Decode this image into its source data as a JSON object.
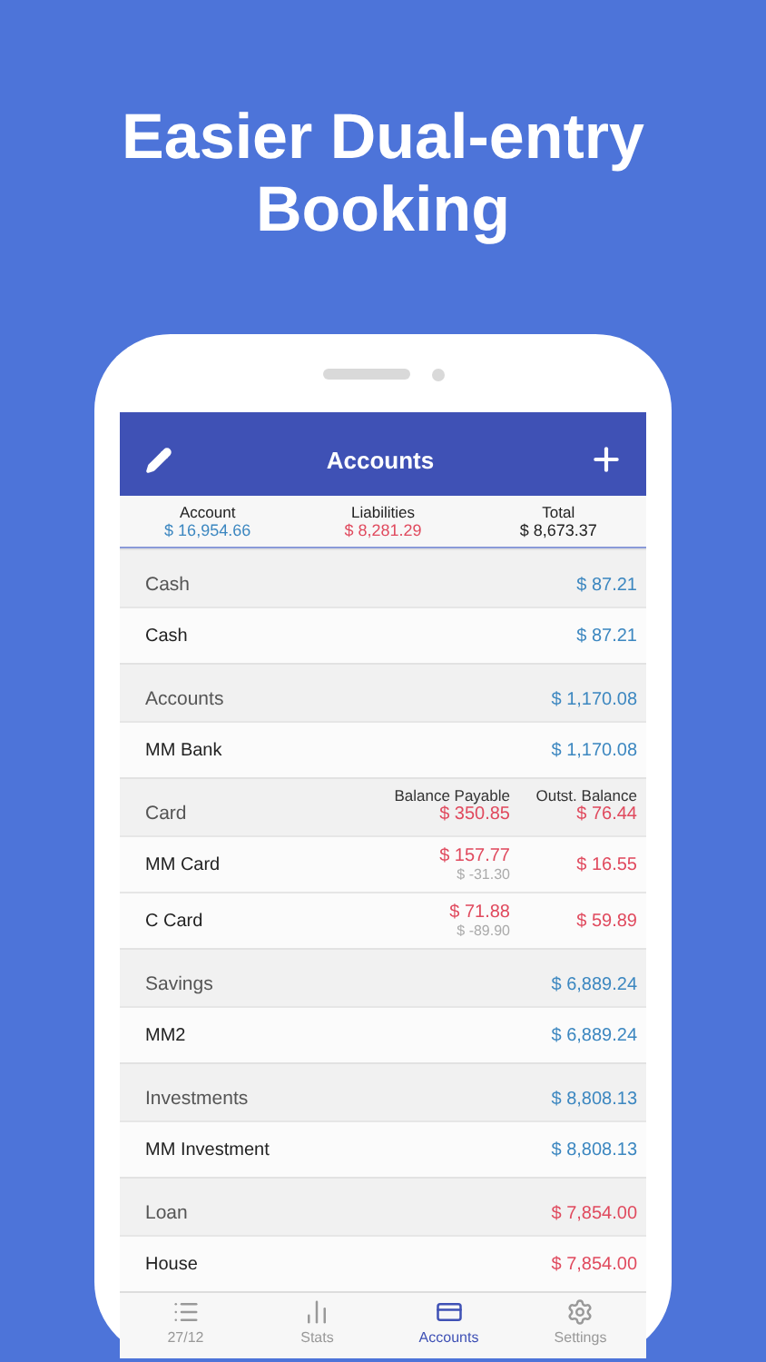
{
  "headline": [
    "Easier Dual-entry",
    "Booking"
  ],
  "screen": {
    "title": "Accounts",
    "summary": [
      {
        "label": "Account",
        "value": "$ 16,954.66",
        "color": "#3c87c0"
      },
      {
        "label": "Liabilities",
        "value": "$ 8,281.29",
        "color": "#e04a5e"
      },
      {
        "label": "Total",
        "value": "$ 8,673.37",
        "color": "#222222"
      }
    ],
    "groups": [
      {
        "kind": "simple",
        "name": "Cash",
        "total": "$ 87.21",
        "color": "#3c87c0",
        "rows": [
          {
            "name": "Cash",
            "amount": "$ 87.21",
            "color": "#3c87c0"
          }
        ]
      },
      {
        "kind": "simple",
        "name": "Accounts",
        "total": "$ 1,170.08",
        "color": "#3c87c0",
        "rows": [
          {
            "name": "MM Bank",
            "amount": "$ 1,170.08",
            "color": "#3c87c0"
          }
        ]
      },
      {
        "kind": "card",
        "name": "Card",
        "column_headers": [
          "Balance Payable",
          "Outst. Balance"
        ],
        "totals": [
          "$ 350.85",
          "$ 76.44"
        ],
        "color": "#e04a5e",
        "rows": [
          {
            "name": "MM Card",
            "payable": "$ 157.77",
            "payable_note": "$ -31.30",
            "outstanding": "$ 16.55",
            "color": "#e04a5e"
          },
          {
            "name": "C Card",
            "payable": "$ 71.88",
            "payable_note": "$ -89.90",
            "outstanding": "$ 59.89",
            "color": "#e04a5e"
          }
        ]
      },
      {
        "kind": "simple",
        "name": "Savings",
        "total": "$ 6,889.24",
        "color": "#3c87c0",
        "rows": [
          {
            "name": "MM2",
            "amount": "$ 6,889.24",
            "color": "#3c87c0"
          }
        ]
      },
      {
        "kind": "simple",
        "name": "Investments",
        "total": "$ 8,808.13",
        "color": "#3c87c0",
        "rows": [
          {
            "name": "MM Investment",
            "amount": "$ 8,808.13",
            "color": "#3c87c0"
          }
        ]
      },
      {
        "kind": "simple",
        "name": "Loan",
        "total": "$ 7,854.00",
        "color": "#e04a5e",
        "rows": [
          {
            "name": "House",
            "amount": "$ 7,854.00",
            "color": "#e04a5e"
          }
        ]
      }
    ],
    "tabs": [
      {
        "kind": "list",
        "label": "27/12",
        "selected": false
      },
      {
        "kind": "stats",
        "label": "Stats",
        "selected": false
      },
      {
        "kind": "accounts",
        "label": "Accounts",
        "selected": true
      },
      {
        "kind": "settings",
        "label": "Settings",
        "selected": false
      }
    ]
  }
}
